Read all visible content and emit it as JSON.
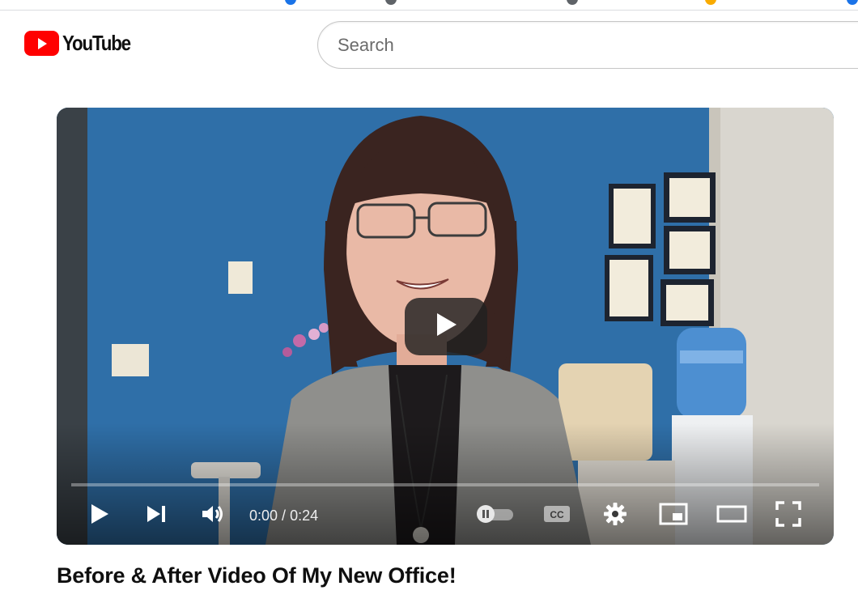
{
  "masthead": {
    "logo_text": "YouTube",
    "logo_icon": "youtube-logo-icon",
    "brand_color": "#ff0000",
    "search": {
      "placeholder": "Search",
      "value": ""
    }
  },
  "player": {
    "big_play_icon": "play-icon",
    "progress": 0,
    "controls": {
      "play_icon": "play-icon",
      "next_icon": "skip-next-icon",
      "volume_icon": "volume-icon",
      "time_current": "0:00",
      "time_separator": "/",
      "time_duration": "0:24",
      "autoplay_icon": "autoplay-toggle-icon",
      "subtitles_icon": "cc-icon",
      "settings_icon": "gear-icon",
      "miniplayer_icon": "miniplayer-icon",
      "theater_icon": "theater-mode-icon",
      "fullscreen_icon": "fullscreen-icon"
    }
  },
  "video": {
    "title": "Before & After Video Of My New Office!"
  }
}
